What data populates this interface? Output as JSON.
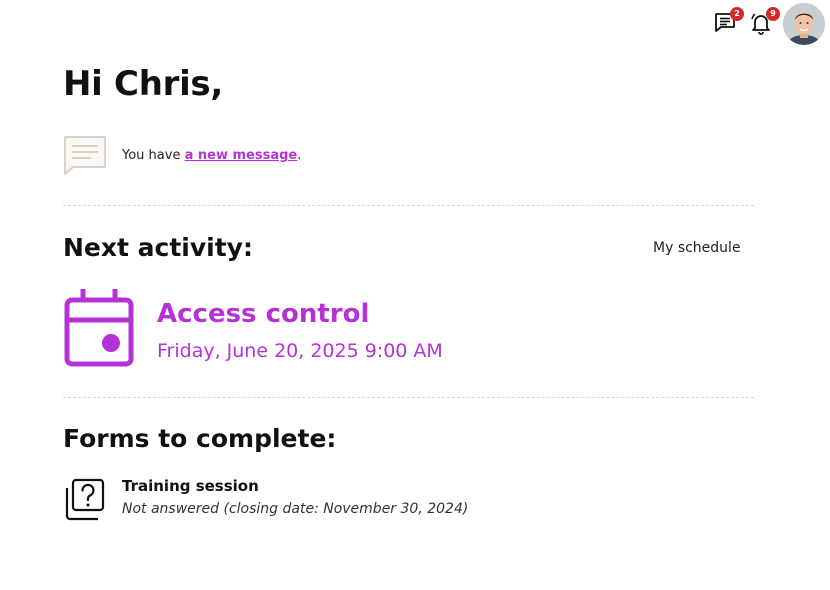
{
  "header": {
    "messages_badge": "2",
    "notifications_badge": "9",
    "messages_icon": "chat-icon",
    "notifications_icon": "bell-icon"
  },
  "greeting": "Hi Chris,",
  "message": {
    "icon": "message-bubble-icon",
    "prefix": "You have ",
    "link_text": "a new message",
    "suffix": "."
  },
  "next_activity": {
    "section_title": "Next activity:",
    "schedule_link": "My schedule",
    "icon": "calendar-icon",
    "title": "Access control",
    "datetime": "Friday, June 20, 2025 9:00 AM"
  },
  "forms": {
    "section_title": "Forms to complete:",
    "items": [
      {
        "icon": "form-question-icon",
        "name": "Training session",
        "status": "Not answered (closing date: November 30, 2024)"
      }
    ]
  },
  "colors": {
    "accent": "#b533d4",
    "badge": "#d62828",
    "icon_muted": "#d9d2c5"
  }
}
